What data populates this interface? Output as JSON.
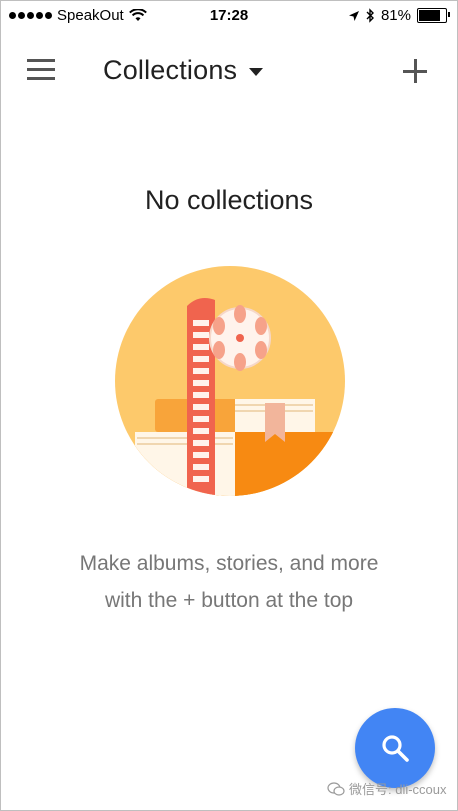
{
  "status_bar": {
    "carrier": "SpeakOut",
    "time": "17:28",
    "battery_percent": "81%",
    "battery_level": 0.81,
    "icons": [
      "signal-dots-icon",
      "wifi-icon",
      "location-arrow-icon",
      "bluetooth-icon",
      "battery-icon"
    ]
  },
  "app_bar": {
    "title": "Collections",
    "menu_icon": "hamburger-menu-icon",
    "dropdown_icon": "caret-down-icon",
    "add_icon": "plus-icon"
  },
  "empty_state": {
    "title": "No collections",
    "description_line1": "Make albums, stories, and more",
    "description_line2": "with the + button at the top",
    "illustration": "film-reel-and-books-illustration"
  },
  "fab": {
    "icon": "search-icon",
    "color": "#4285f4"
  },
  "watermark": {
    "text": "微信号: dli-ccoux",
    "icon": "wechat-icon"
  },
  "colors": {
    "illustration_circle": "#fdc96b",
    "book_orange": "#f59a1e",
    "film_red": "#f0644e",
    "reel_white": "#fff3ec"
  }
}
